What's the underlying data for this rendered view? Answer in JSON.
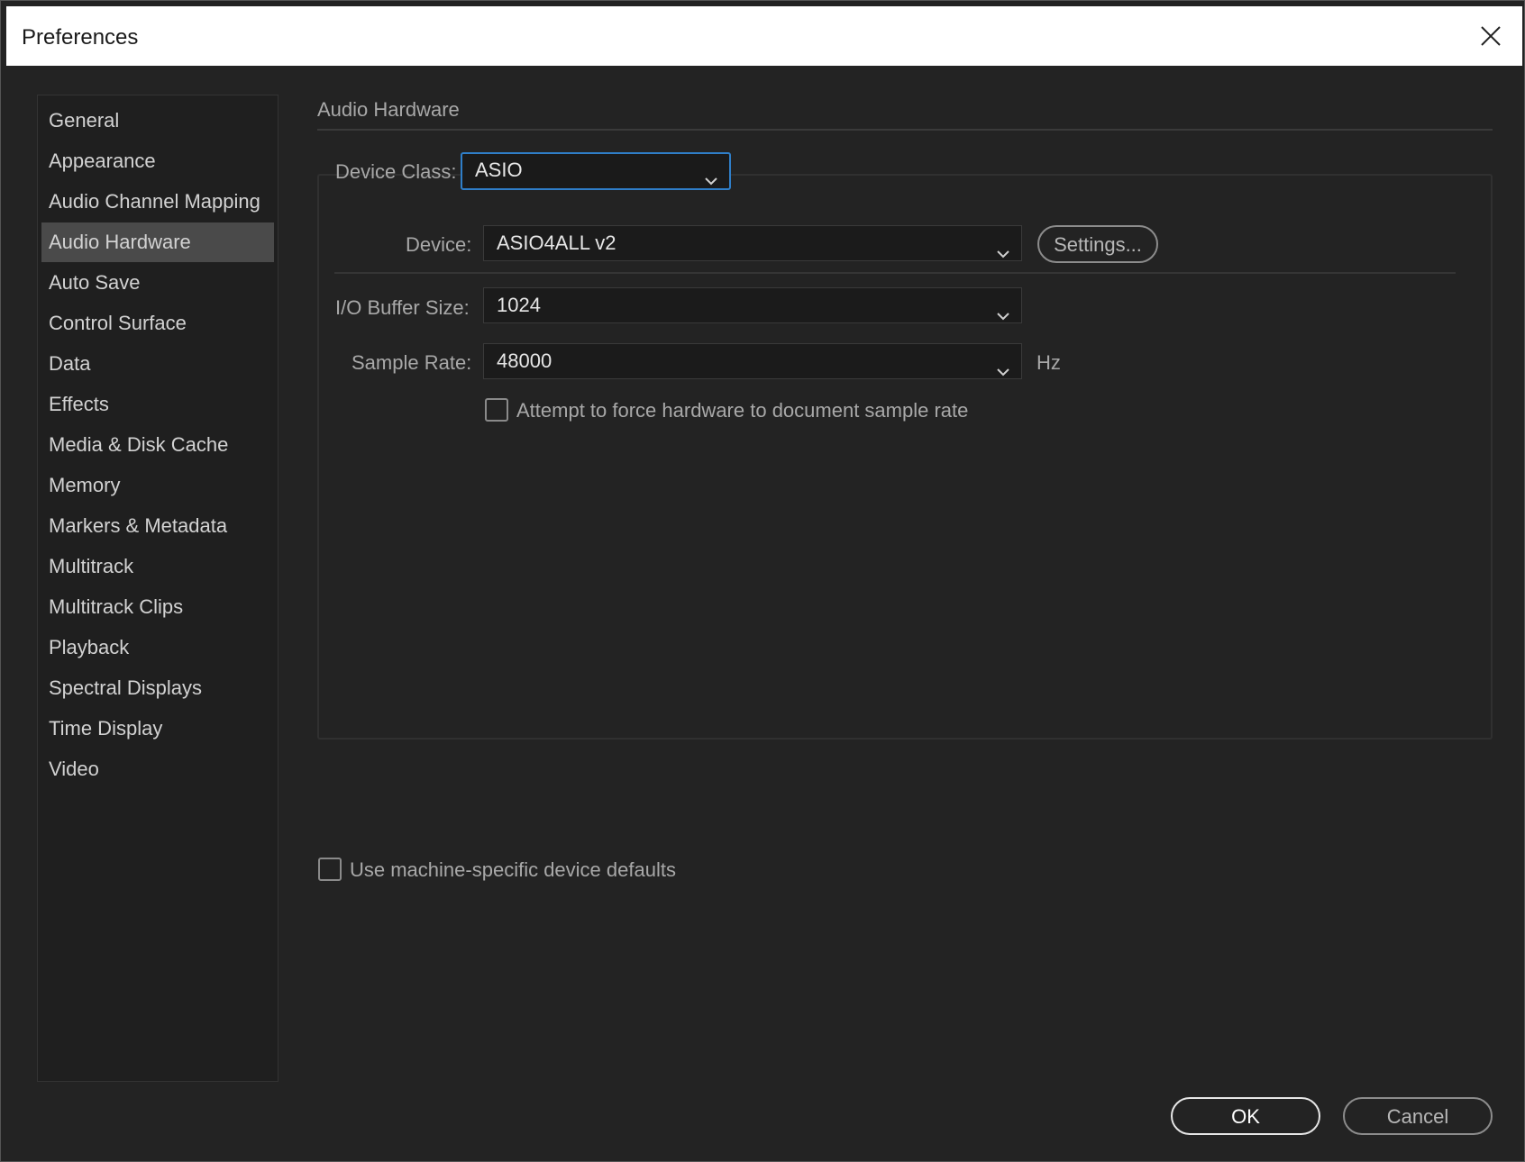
{
  "window": {
    "title": "Preferences"
  },
  "sidebar": {
    "items": [
      {
        "label": "General"
      },
      {
        "label": "Appearance"
      },
      {
        "label": "Audio Channel Mapping"
      },
      {
        "label": "Audio Hardware",
        "selected": true
      },
      {
        "label": "Auto Save"
      },
      {
        "label": "Control Surface"
      },
      {
        "label": "Data"
      },
      {
        "label": "Effects"
      },
      {
        "label": "Media & Disk Cache"
      },
      {
        "label": "Memory"
      },
      {
        "label": "Markers & Metadata"
      },
      {
        "label": "Multitrack"
      },
      {
        "label": "Multitrack Clips"
      },
      {
        "label": "Playback"
      },
      {
        "label": "Spectral Displays"
      },
      {
        "label": "Time Display"
      },
      {
        "label": "Video"
      }
    ]
  },
  "main": {
    "section_title": "Audio Hardware",
    "device_class": {
      "label": "Device Class:",
      "value": "ASIO"
    },
    "device": {
      "label": "Device:",
      "value": "ASIO4ALL v2",
      "settings_label": "Settings..."
    },
    "buffer_size": {
      "label": "I/O Buffer Size:",
      "value": "1024"
    },
    "sample_rate": {
      "label": "Sample Rate:",
      "value": "48000",
      "unit": "Hz"
    },
    "force_rate": {
      "label": "Attempt to force hardware to document sample rate",
      "checked": false
    },
    "machine_defaults": {
      "label": "Use machine-specific device defaults",
      "checked": false
    }
  },
  "footer": {
    "ok_label": "OK",
    "cancel_label": "Cancel"
  },
  "colors": {
    "focus_accent": "#2f7ec8",
    "selected_item_bg": "#4a4a4a",
    "dialog_bg": "#232323"
  }
}
